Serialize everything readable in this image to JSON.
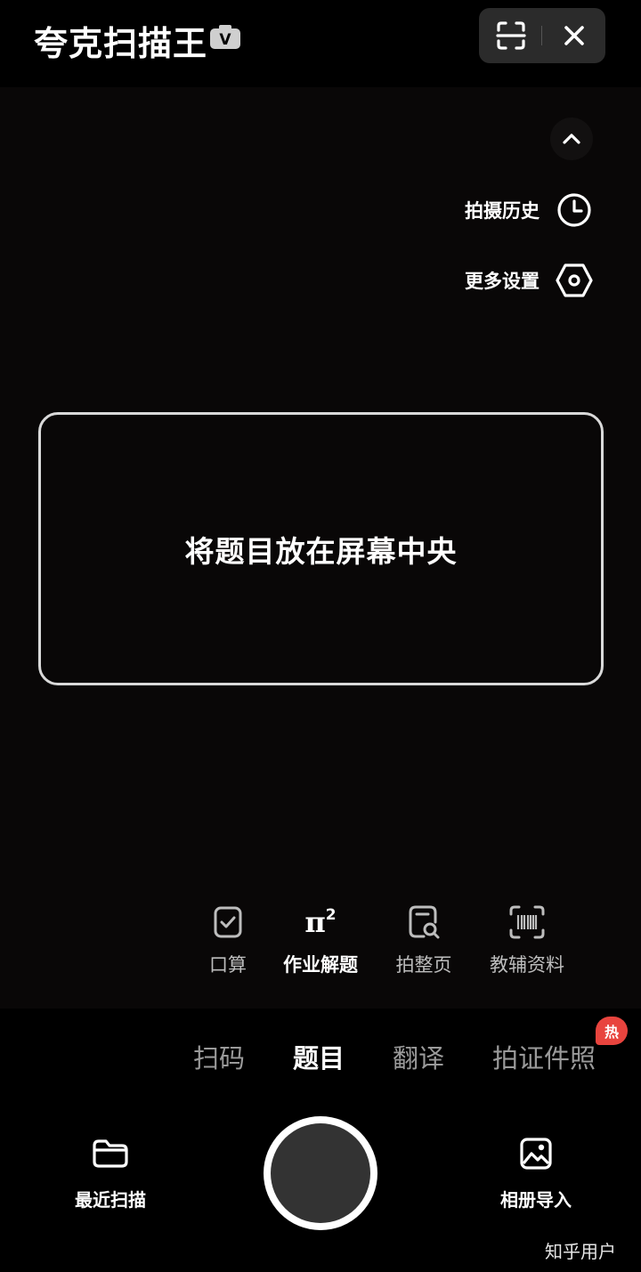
{
  "header": {
    "app_title": "夸克扫描王",
    "vip_badge": "V",
    "scan_icon": "scan-frame-icon",
    "close_icon": "close-icon"
  },
  "side_options": {
    "collapse_icon": "chevron-up-icon",
    "history_label": "拍摄历史",
    "history_icon": "clock-icon",
    "settings_label": "更多设置",
    "settings_icon": "hexagon-settings-icon"
  },
  "viewfinder": {
    "hint": "将题目放在屏幕中央"
  },
  "submodes": [
    {
      "label": "口算",
      "icon": "check-document-icon",
      "active": false
    },
    {
      "label": "作业解题",
      "icon": "pi-squared-icon",
      "icon_text": "π",
      "icon_sup": "2",
      "active": true
    },
    {
      "label": "拍整页",
      "icon": "page-search-icon",
      "active": false
    },
    {
      "label": "教辅资料",
      "icon": "barcode-scan-icon",
      "active": false
    }
  ],
  "mode_tabs": [
    {
      "label": "扫码",
      "active": false
    },
    {
      "label": "题目",
      "active": true
    },
    {
      "label": "翻译",
      "active": false
    },
    {
      "label": "拍证件照",
      "active": false,
      "badge": "热"
    }
  ],
  "bottom": {
    "recent_label": "最近扫描",
    "recent_icon": "folder-icon",
    "album_label": "相册导入",
    "album_icon": "image-icon"
  },
  "watermark": "知乎用户",
  "colors": {
    "background": "#000000",
    "viewfinder": "#090707",
    "hot_badge": "#e8443e",
    "inactive_tab": "#9a9a9a"
  }
}
